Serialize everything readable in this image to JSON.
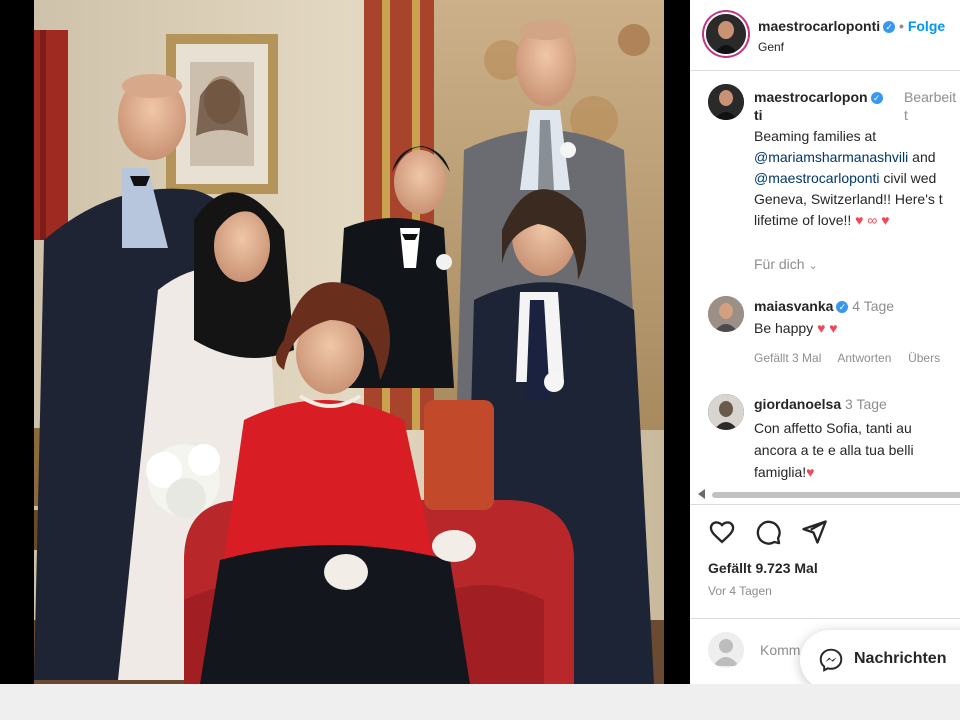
{
  "post": {
    "author": "maestrocarloponti",
    "follow_label": "Folge",
    "location": "Genf"
  },
  "caption": {
    "author_line1": "maestrocarlopon",
    "author_line2": "ti",
    "edited_line1": "Bearbeit",
    "edited_line2": "t",
    "line1": "Beaming families at",
    "line2_mention": "@mariamsharmanashvili",
    "line2_rest": " and",
    "line3_mention": "@maestrocarloponti",
    "line3_rest": " civil wed",
    "line4": "Geneva, Switzerland!! Here's t",
    "line5": "lifetime of love!!",
    "line5_emoji": "♥ ∞ ♥",
    "translate_label": "Für dich"
  },
  "comments": [
    {
      "user": "maiasvanka",
      "age": "4 Tage",
      "text": "Be happy",
      "emoji": "♥ ♥",
      "likes": "Gefällt 3 Mal",
      "reply": "Antworten",
      "translate": "Übers"
    },
    {
      "user": "giordanoelsa",
      "age": "3 Tage",
      "line1": "Con affetto Sofia, tanti au",
      "line2": "ancora a te e alla tua belli",
      "line3": "famiglia!",
      "emoji": "♥"
    }
  ],
  "actions": {
    "like_icon": "heart-outline-icon",
    "comment_icon": "comment-bubble-icon",
    "share_icon": "paper-plane-icon"
  },
  "stats": {
    "likes": "Gefällt 9.723 Mal",
    "time": "Vor 4 Tagen"
  },
  "composer": {
    "placeholder": "Komm"
  },
  "messages": {
    "label": "Nachrichten",
    "icon": "messenger-icon"
  },
  "colors": {
    "verified": "#3897f0",
    "link": "#00376b",
    "follow": "#0095f6",
    "heart": "#ed4956",
    "muted": "#8e8e8e"
  }
}
